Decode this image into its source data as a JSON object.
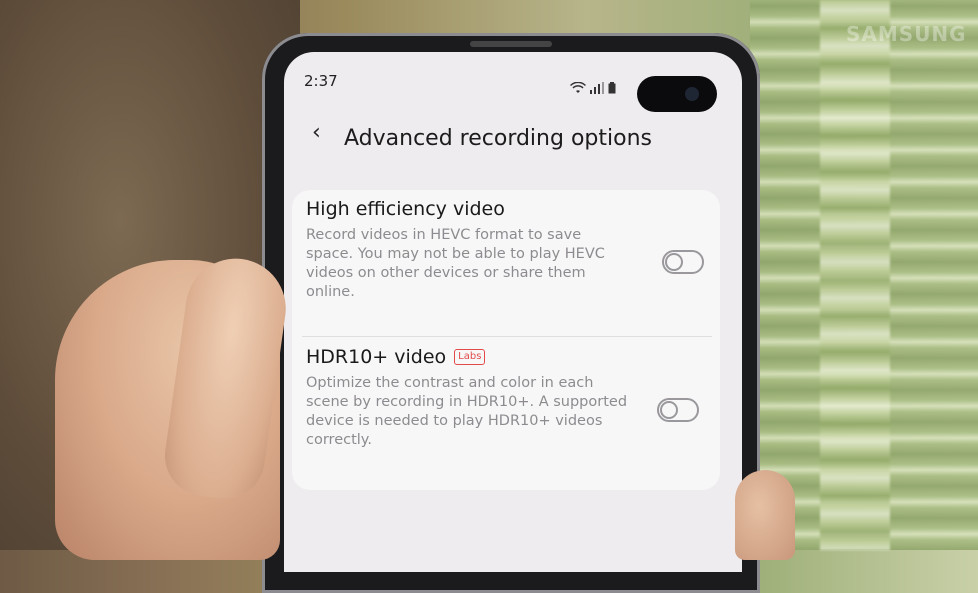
{
  "watermark": "SAMSUNG",
  "status": {
    "time": "2:37"
  },
  "header": {
    "title": "Advanced recording options"
  },
  "settings": [
    {
      "title": "High efficiency video",
      "description": "Record videos in HEVC format to save space. You may not be able to play HEVC videos on other devices or share them online.",
      "enabled": false
    },
    {
      "title": "HDR10+ video",
      "badge": "Labs",
      "description": "Optimize the contrast and color in each scene by recording in HDR10+. A supported device is needed to play HDR10+ videos correctly.",
      "enabled": false
    }
  ],
  "icons": [
    "back-arrow-icon",
    "wifi-icon",
    "signal-icon",
    "battery-icon"
  ],
  "colors": {
    "badge": "#e24a4a",
    "screen_bg": "#efecef",
    "card_bg": "#f8f7f8"
  }
}
